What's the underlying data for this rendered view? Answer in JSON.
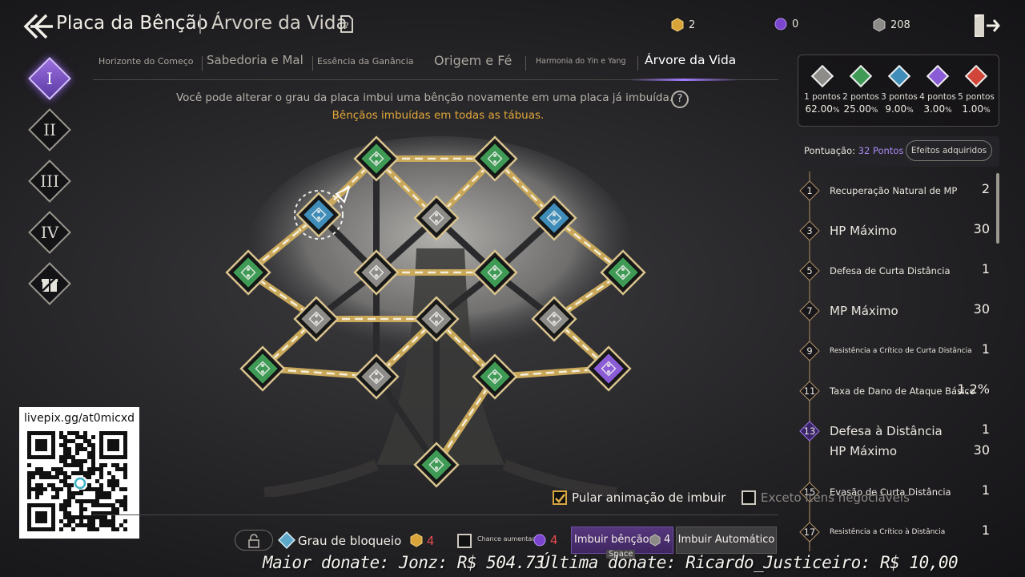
{
  "header": {
    "title": "Placa da Bênção",
    "subtitle": "Árvore da Vida",
    "currencies": [
      {
        "icon": "gold-coin-icon",
        "value": "2"
      },
      {
        "icon": "purple-gem-icon",
        "value": "0"
      },
      {
        "icon": "silver-stone-icon",
        "value": "208"
      }
    ]
  },
  "tiers": [
    "I",
    "II",
    "III",
    "IV"
  ],
  "tabs": [
    {
      "label": "Horizonte do Começo"
    },
    {
      "label": "Sabedoria e Mal"
    },
    {
      "label": "Essência da Ganância"
    },
    {
      "label": "Origem e Fé"
    },
    {
      "label": "Harmonia do Yin e Yang"
    },
    {
      "label": "Árvore da Vida"
    }
  ],
  "info": {
    "line1": "Você pode alterar o grau da placa imbui uma bênção novamente em uma placa já imbuída.",
    "help": "?",
    "line2": "Bênçãos imbuídas em todas as tábuas."
  },
  "rarity": {
    "colors": [
      "#8d8c88",
      "#3f9a56",
      "#3f8db8",
      "#8a5cd6",
      "#d0473a"
    ],
    "items": [
      {
        "points": "1 pontos",
        "value": "62.00",
        "unit": "%"
      },
      {
        "points": "2 pontos",
        "value": "25.00",
        "unit": "%"
      },
      {
        "points": "3 pontos",
        "value": "9.00",
        "unit": "%"
      },
      {
        "points": "4 pontos",
        "value": "3.00",
        "unit": "%"
      },
      {
        "points": "5 pontos",
        "value": "1.00",
        "unit": "%"
      }
    ]
  },
  "score": {
    "label": "Pontuação:",
    "points": "32 Pontos",
    "effects_button": "Efeitos adquiridos"
  },
  "effects": [
    {
      "level": "1",
      "name": "Recuperação Natural de MP",
      "value": "2"
    },
    {
      "level": "3",
      "name": "HP Máximo",
      "value": "30"
    },
    {
      "level": "5",
      "name": "Defesa de Curta Distância",
      "value": "1"
    },
    {
      "level": "7",
      "name": "MP Máximo",
      "value": "30"
    },
    {
      "level": "9",
      "name": "Resistência a Crítico de Curta Distância",
      "value": "1"
    },
    {
      "level": "11",
      "name": "Taxa de Dano de Ataque Básico",
      "value": "1.2%"
    },
    {
      "level": "13",
      "name": "Defesa à Distância",
      "value": "1",
      "name2": "HP Máximo",
      "value2": "30"
    },
    {
      "level": "15",
      "name": "Evasão de Curta Distância",
      "value": "1"
    },
    {
      "level": "17",
      "name": "Resistência a Crítico à Distância",
      "value": "1"
    }
  ],
  "board": {
    "node_colors": {
      "green": "#3f9a56",
      "gray": "#8d8c88",
      "blue": "#3f8db8",
      "purple": "#8a5cd6"
    }
  },
  "qr": {
    "label": "livepix.gg/at0micxd"
  },
  "options": {
    "skip_animation": "Pular animação de imbuir",
    "except_tradeable": "Exceto itens negociáveis"
  },
  "bottom": {
    "grau_label": "Grau de bloqueio",
    "grau_cost": "4",
    "chance_label": "Chance aumentada",
    "chance_cost": "4",
    "imbuir_label": "Imbuir bênção",
    "imbuir_cost": "4",
    "auto_label": "Imbuir Automático",
    "space_hint": "Space"
  },
  "donations": {
    "top": "Maior donate: Jonz: R$  504.73",
    "last": "Última donate: Ricardo_Justiceiro: R$ 10,00"
  }
}
